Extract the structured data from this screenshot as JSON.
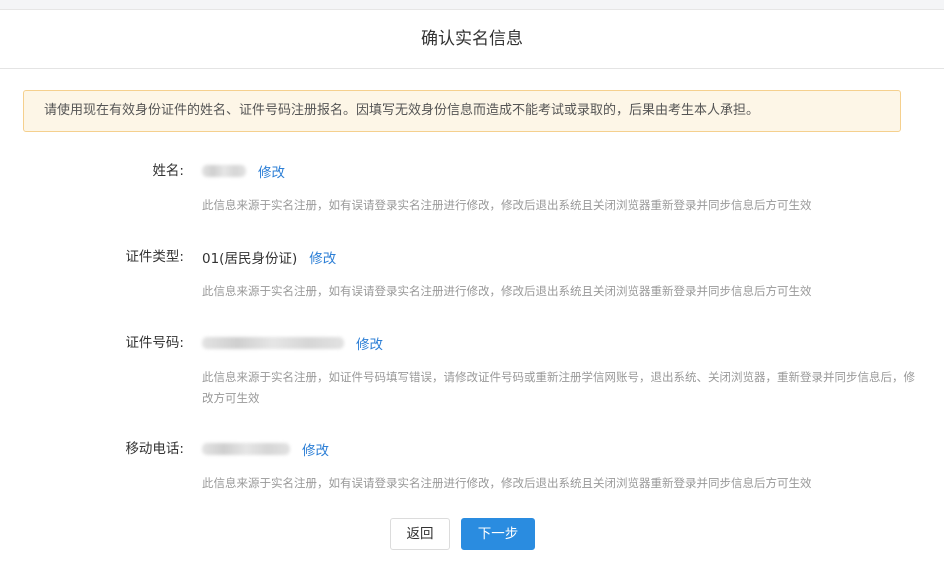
{
  "page": {
    "title": "确认实名信息"
  },
  "notice": {
    "text": "请使用现在有效身份证件的姓名、证件号码注册报名。因填写无效身份信息而造成不能考试或录取的，后果由考生本人承担。"
  },
  "fields": [
    {
      "label": "姓名:",
      "value": "",
      "edit_label": "修改",
      "hint": "此信息来源于实名注册，如有误请登录实名注册进行修改，修改后退出系统且关闭浏览器重新登录并同步信息后方可生效"
    },
    {
      "label": "证件类型:",
      "value": "01(居民身份证)",
      "edit_label": "修改",
      "hint": "此信息来源于实名注册，如有误请登录实名注册进行修改，修改后退出系统且关闭浏览器重新登录并同步信息后方可生效"
    },
    {
      "label": "证件号码:",
      "value": "",
      "edit_label": "修改",
      "hint": "此信息来源于实名注册，如证件号码填写错误，请修改证件号码或重新注册学信网账号，退出系统、关闭浏览器，重新登录并同步信息后，修改方可生效"
    },
    {
      "label": "移动电话:",
      "value": "",
      "edit_label": "修改",
      "hint": "此信息来源于实名注册，如有误请登录实名注册进行修改，修改后退出系统且关闭浏览器重新登录并同步信息后方可生效"
    }
  ],
  "actions": {
    "back_label": "返回",
    "next_label": "下一步"
  },
  "colors": {
    "link": "#2d7fd6",
    "primary_button": "#2a8ce0",
    "notice_bg": "#fdf6e7",
    "notice_border": "#f5d08e"
  }
}
